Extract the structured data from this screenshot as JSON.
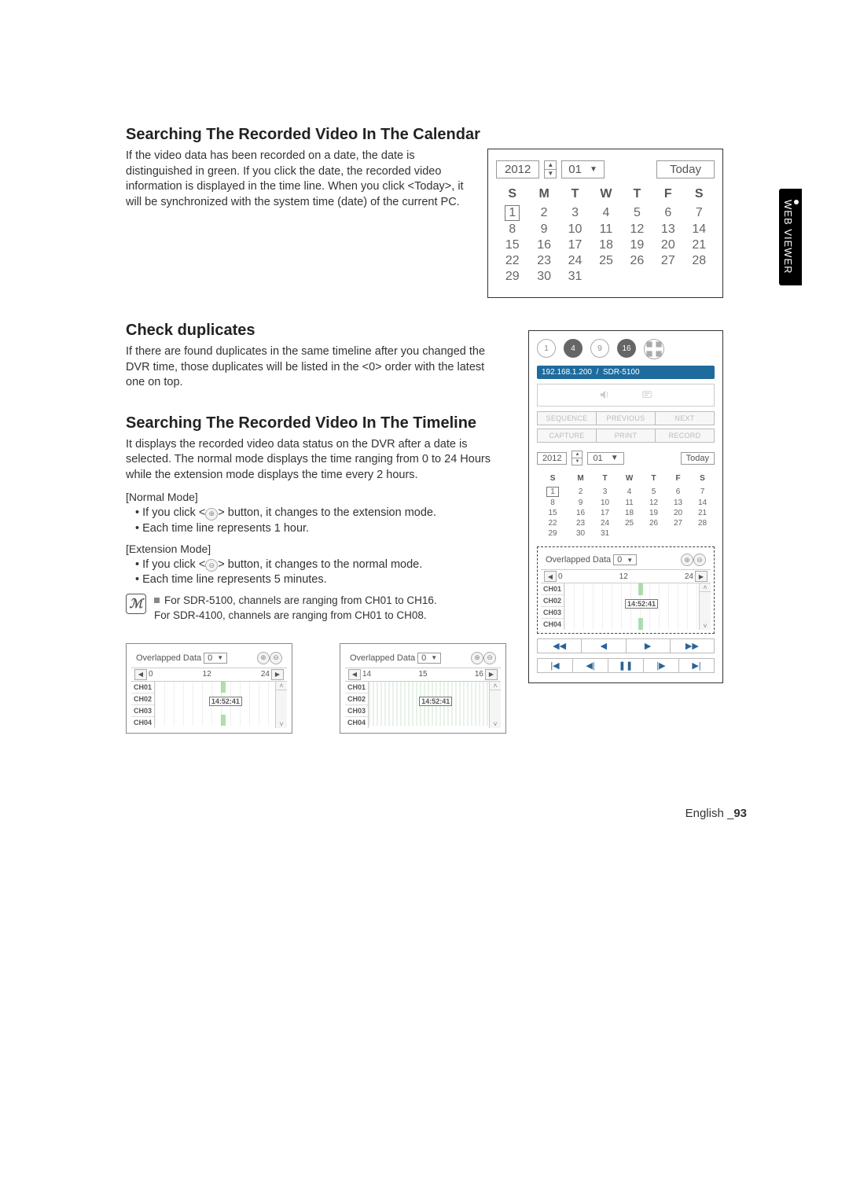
{
  "side_tab": "WEB VIEWER",
  "section1": {
    "heading": "Searching The Recorded Video In The Calendar",
    "para": "If the video data has been recorded on a date, the date is distinguished in green. If you click the date, the recorded video information is displayed in the time line. When you click <Today>, it will be synchronized with the system time (date) of the current PC."
  },
  "section2": {
    "heading": "Check duplicates",
    "para": "If there are found duplicates in the same timeline after you changed the DVR time, those duplicates will be listed in the <0> order with the latest one on top."
  },
  "section3": {
    "heading": "Searching The Recorded Video In The Timeline",
    "para": "It displays the recorded video data status on the DVR after a date is selected. The normal mode displays the time ranging from 0 to 24 Hours while the extension mode displays the time every 2 hours.",
    "normal_label": "[Normal Mode]",
    "normal_bullets": [
      "If you click <  > button, it changes to the extension mode.",
      "Each time line represents 1 hour."
    ],
    "ext_label": "[Extension Mode]",
    "ext_bullets": [
      "If you click <  > button, it changes to the normal mode.",
      "Each time line represents 5 minutes."
    ],
    "note1": "For SDR-5100, channels are ranging from CH01 to CH16.",
    "note2": "For SDR-4100, channels are ranging from CH01 to CH08."
  },
  "calendar": {
    "year": "2012",
    "month": "01",
    "today": "Today",
    "dow": [
      "S",
      "M",
      "T",
      "W",
      "T",
      "F",
      "S"
    ],
    "rows": [
      [
        "1",
        "2",
        "3",
        "4",
        "5",
        "6",
        "7"
      ],
      [
        "8",
        "9",
        "10",
        "11",
        "12",
        "13",
        "14"
      ],
      [
        "15",
        "16",
        "17",
        "18",
        "19",
        "20",
        "21"
      ],
      [
        "22",
        "23",
        "24",
        "25",
        "26",
        "27",
        "28"
      ],
      [
        "29",
        "30",
        "31",
        "",
        "",
        "",
        ""
      ]
    ]
  },
  "app": {
    "nums": [
      "1",
      "4",
      "9",
      "16"
    ],
    "ip": "192.168.1.200",
    "sep": "/",
    "model": "SDR-5100",
    "row1": [
      "SEQUENCE",
      "PREVIOUS",
      "NEXT"
    ],
    "row2": [
      "CAPTURE",
      "PRINT",
      "RECORD"
    ]
  },
  "timeline": {
    "label": "Overlapped Data",
    "sel": "0",
    "time_mark": "14:52:41",
    "channels": [
      "CH01",
      "CH02",
      "CH03",
      "CH04"
    ],
    "normal_ruler": {
      "l": "0",
      "m": "12",
      "r": "24"
    },
    "ext_ruler": {
      "l": "14",
      "m": "15",
      "r": "16"
    }
  },
  "playback": {
    "row1": [
      "◀◀",
      "◀",
      "▶",
      "▶▶"
    ],
    "row2": [
      "|◀",
      "◀|",
      "❚❚",
      "|▶",
      "▶|"
    ]
  },
  "footer": {
    "lang": "English",
    "sep": "_",
    "page": "93"
  }
}
